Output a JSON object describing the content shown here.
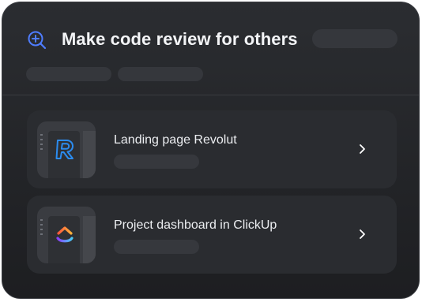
{
  "header": {
    "title": "Make code review for others",
    "icon": "zoom-in-icon",
    "accent_color": "#4f7dff"
  },
  "items": [
    {
      "label": "Landing page Revolut",
      "icon": "revolut-logo-icon"
    },
    {
      "label": "Project dashboard in ClickUp",
      "icon": "clickup-logo-icon"
    }
  ]
}
